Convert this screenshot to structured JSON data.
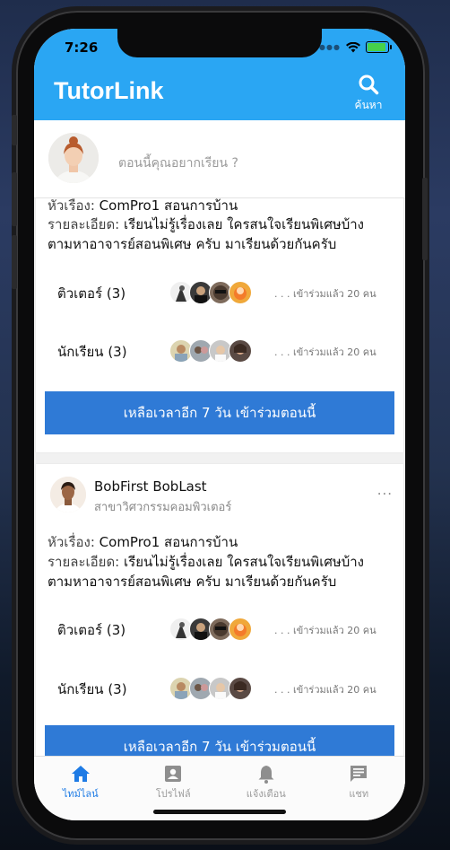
{
  "status": {
    "time": "7:26"
  },
  "header": {
    "title": "TutorLink",
    "search_label": "ค้นหา"
  },
  "composer": {
    "placeholder": "ตอนนี้คุณอยากเรียน ?"
  },
  "posts": [
    {
      "topic_key": "หัวเรื่อง:",
      "topic_value": "ComPro1 สอนการบ้าน",
      "detail_key": "รายละเอียด:",
      "detail_line1": "เรียนไม่รู้เรื่องเลย ใครสนใจเรียนพิเศษบ้าง",
      "detail_line2": "ตามหาอาจารย์สอนพิเศษ ครับ มาเรียนด้วยกันครับ",
      "tutor_label": "ติวเตอร์ (3)",
      "tutor_joined": ". . . เข้าร่วมแล้ว 20 คน",
      "student_label": "นักเรียน (3)",
      "student_joined": ". . . เข้าร่วมแล้ว 20 คน",
      "join_button": "เหลือเวลาอีก 7 วัน เข้าร่วมตอนนี้"
    },
    {
      "author": "BobFirst BobLast",
      "department": "สาขาวิศวกรรมคอมพิวเตอร์",
      "more": "...",
      "topic_key": "หัวเรื่อง:",
      "topic_value": "ComPro1 สอนการบ้าน",
      "detail_key": "รายละเอียด:",
      "detail_line1": "เรียนไม่รู้เรื่องเลย ใครสนใจเรียนพิเศษบ้าง",
      "detail_line2": "ตามหาอาจารย์สอนพิเศษ ครับ มาเรียนด้วยกันครับ",
      "tutor_label": "ติวเตอร์ (3)",
      "tutor_joined": ". . . เข้าร่วมแล้ว 20 คน",
      "student_label": "นักเรียน (3)",
      "student_joined": ". . . เข้าร่วมแล้ว 20 คน",
      "join_button": "เหลือเวลาอีก 7 วัน เข้าร่วมตอนนี้"
    }
  ],
  "tabbar": {
    "items": [
      {
        "label": "ไทม์ไลน์",
        "icon": "home-icon",
        "active": true
      },
      {
        "label": "โปรไฟล์",
        "icon": "profile-icon",
        "active": false
      },
      {
        "label": "แจ้งเตือน",
        "icon": "bell-icon",
        "active": false
      },
      {
        "label": "แชท",
        "icon": "chat-icon",
        "active": false
      }
    ]
  },
  "colors": {
    "header": "#2aa6f3",
    "button": "#2f7ad6",
    "active_tab": "#1e7be5"
  }
}
